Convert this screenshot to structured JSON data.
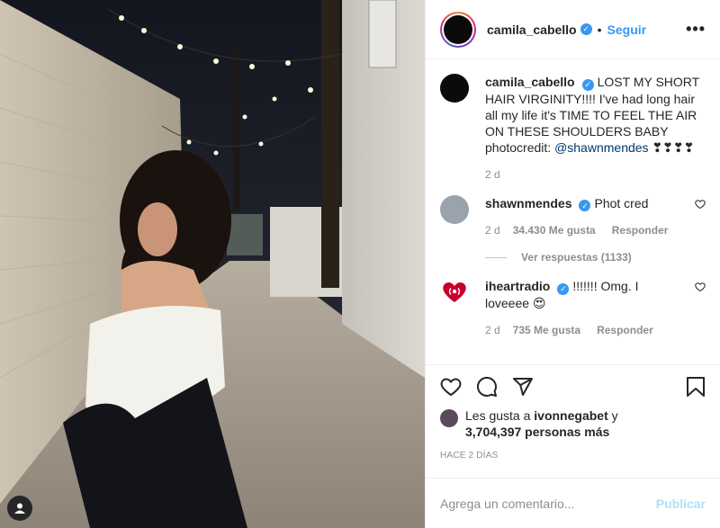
{
  "post": {
    "author": "camila_cabello",
    "follow_label": "Seguir",
    "separator": "•",
    "more_label": "•••"
  },
  "caption": {
    "username": "camila_cabello",
    "text": "LOST MY SHORT HAIR VIRGINITY!!!! I've had long hair all my life it's TIME TO FEEL THE AIR ON THESE SHOULDERS BABY photocredit: ",
    "mention": "@shawnmendes",
    "emoji": "❣❣❣❣",
    "time": "2 d"
  },
  "comments": [
    {
      "username": "shawnmendes",
      "text": "Phot cred",
      "time": "2 d",
      "likes": "34.430 Me gusta",
      "reply": "Responder",
      "view_replies": "Ver respuestas (1133)"
    },
    {
      "username": "iheartradio",
      "text": "!!!!!!! Omg. I loveeee 😍",
      "time": "2 d",
      "likes": "735 Me gusta",
      "reply": "Responder"
    }
  ],
  "likes": {
    "prefix": "Les gusta a ",
    "first_user": "ivonnegabet",
    "middle": " y",
    "count": "3,704,397 personas más"
  },
  "timestamp": "HACE 2 DÍAS",
  "composer": {
    "placeholder": "Agrega un comentario...",
    "publish": "Publicar"
  },
  "colors": {
    "link_blue": "#3897f0",
    "text": "#262626",
    "muted": "#8e8e8e",
    "iheart_red": "#c6002b"
  },
  "icons": [
    "verified-badge-icon",
    "more-options-icon",
    "heart-icon",
    "comment-icon",
    "share-icon",
    "bookmark-icon",
    "user-tag-icon"
  ]
}
